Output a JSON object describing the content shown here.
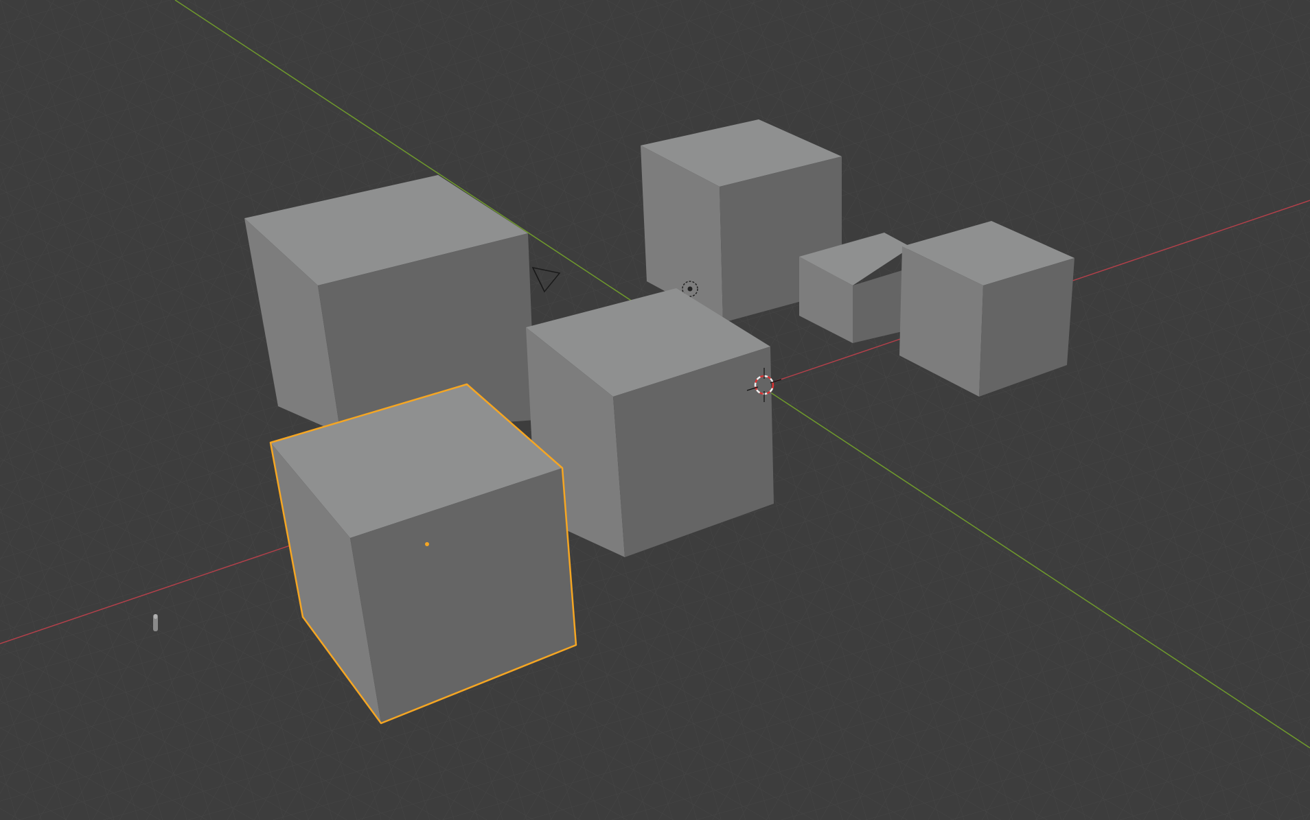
{
  "viewport": {
    "name": "3D Viewport",
    "background": "#3d3d3d",
    "grid_color": "#4a4a4a",
    "axis_x_color": "#b3404a",
    "axis_y_color": "#6f9a2c",
    "selection_color": "#f5a623"
  },
  "scene": {
    "objects": [
      {
        "name": "cube-large-back-left",
        "selected": false
      },
      {
        "name": "cube-tall-back",
        "selected": false
      },
      {
        "name": "cube-small-right",
        "selected": false
      },
      {
        "name": "cube-right",
        "selected": false
      },
      {
        "name": "cube-center",
        "selected": false
      },
      {
        "name": "cube-front-selected",
        "selected": true
      }
    ],
    "helpers": [
      "camera-icon",
      "light-icon",
      "3d-cursor-icon",
      "empty-object-icon",
      "origin-point"
    ]
  },
  "face_colors": {
    "top": "#8f9090",
    "left": "#7d7d7d",
    "right": "#656565"
  }
}
